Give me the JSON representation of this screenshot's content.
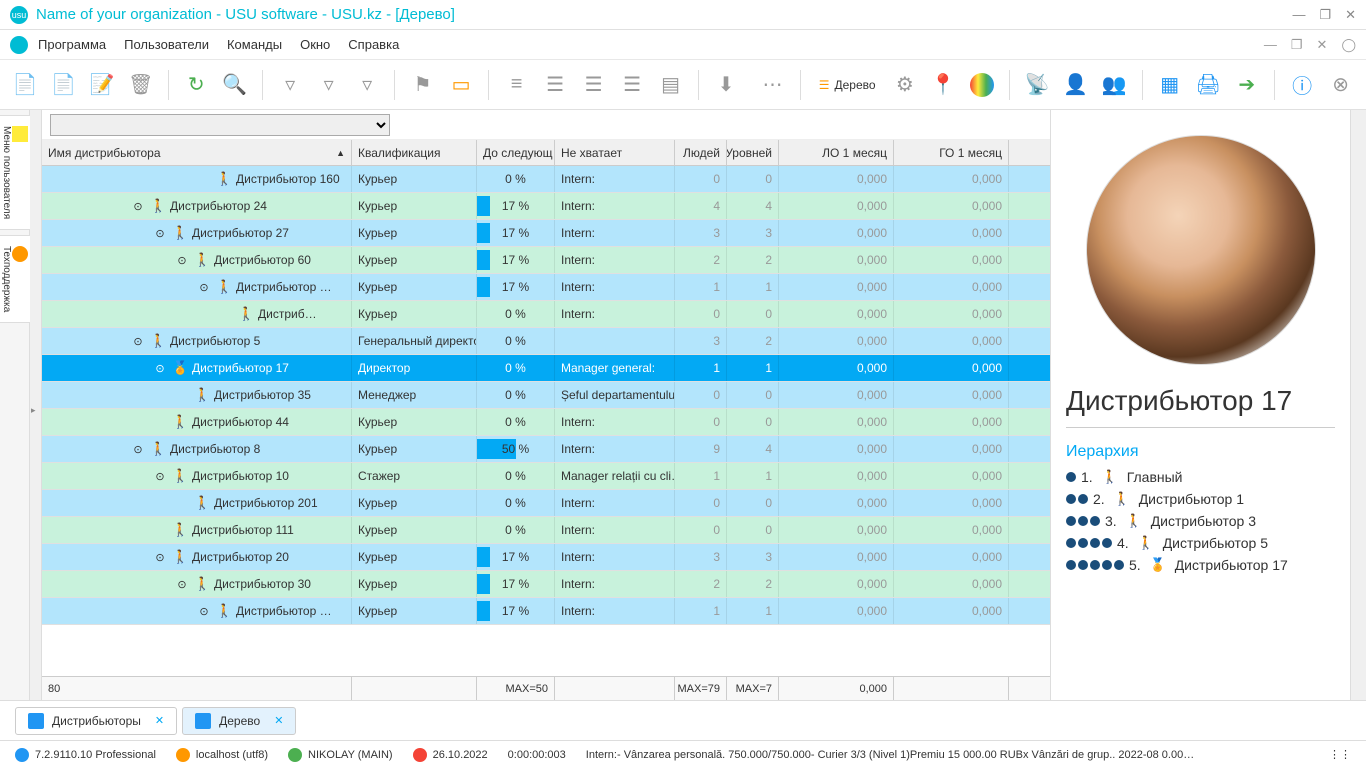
{
  "window": {
    "title": "Name of your organization - USU software - USU.kz - [Дерево]"
  },
  "menu": {
    "items": [
      "Программа",
      "Пользователи",
      "Команды",
      "Окно",
      "Справка"
    ]
  },
  "toolbar": {
    "tree_label": "Дерево"
  },
  "side_tabs": {
    "label1": "Меню пользователя",
    "label2": "Техподдержка"
  },
  "columns": {
    "name": "Имя дистрибьютора",
    "kval": "Квалификация",
    "next": "До следующ…",
    "miss": "Не хватает",
    "people": "Людей",
    "levels": "Уровней",
    "lo": "ЛО 1 месяц",
    "go": "ГО 1 месяц"
  },
  "rows": [
    {
      "indent": 7,
      "exp": "",
      "ico": "pc-blue",
      "name": "Дистрибьютор 160",
      "kval": "Курьер",
      "pct": 0,
      "miss": "Intern:",
      "ppl": "0",
      "lvl": "0",
      "lo": "0,000",
      "go": "0,000",
      "alt": "even"
    },
    {
      "indent": 4,
      "exp": "⊙",
      "ico": "pc-blue",
      "name": "Дистрибьютор 24",
      "kval": "Курьер",
      "pct": 17,
      "miss": "Intern:",
      "ppl": "4",
      "lvl": "4",
      "lo": "0,000",
      "go": "0,000",
      "alt": "odd"
    },
    {
      "indent": 5,
      "exp": "⊙",
      "ico": "pc-blue",
      "name": "Дистрибьютор 27",
      "kval": "Курьер",
      "pct": 17,
      "miss": "Intern:",
      "ppl": "3",
      "lvl": "3",
      "lo": "0,000",
      "go": "0,000",
      "alt": "even"
    },
    {
      "indent": 6,
      "exp": "⊙",
      "ico": "pc-blue",
      "name": "Дистрибьютор 60",
      "kval": "Курьер",
      "pct": 17,
      "miss": "Intern:",
      "ppl": "2",
      "lvl": "2",
      "lo": "0,000",
      "go": "0,000",
      "alt": "odd"
    },
    {
      "indent": 7,
      "exp": "⊙",
      "ico": "pc-blue",
      "name": "Дистрибьютор …",
      "kval": "Курьер",
      "pct": 17,
      "miss": "Intern:",
      "ppl": "1",
      "lvl": "1",
      "lo": "0,000",
      "go": "0,000",
      "alt": "even"
    },
    {
      "indent": 8,
      "exp": "",
      "ico": "pc-blue",
      "name": "Дистриб…",
      "kval": "Курьер",
      "pct": 0,
      "miss": "Intern:",
      "ppl": "0",
      "lvl": "0",
      "lo": "0,000",
      "go": "0,000",
      "alt": "odd"
    },
    {
      "indent": 4,
      "exp": "⊙",
      "ico": "pc-orange",
      "name": "Дистрибьютор 5",
      "kval": "Генеральный директор",
      "pct": 0,
      "miss": "",
      "ppl": "3",
      "lvl": "2",
      "lo": "0,000",
      "go": "0,000",
      "alt": "even"
    },
    {
      "indent": 5,
      "exp": "⊙",
      "ico": "pc-orange",
      "name": "Дистрибьютор 17",
      "kval": "Директор",
      "pct": 0,
      "miss": "Manager general:",
      "ppl": "1",
      "lvl": "1",
      "lo": "0,000",
      "go": "0,000",
      "alt": "sel",
      "star": true
    },
    {
      "indent": 6,
      "exp": "",
      "ico": "pc-brown",
      "name": "Дистрибьютор 35",
      "kval": "Менеджер",
      "pct": 0,
      "miss": "Șeful departamentului:",
      "ppl": "0",
      "lvl": "0",
      "lo": "0,000",
      "go": "0,000",
      "alt": "even"
    },
    {
      "indent": 5,
      "exp": "",
      "ico": "pc-blue",
      "name": "Дистрибьютор 44",
      "kval": "Курьер",
      "pct": 0,
      "miss": "Intern:",
      "ppl": "0",
      "lvl": "0",
      "lo": "0,000",
      "go": "0,000",
      "alt": "odd"
    },
    {
      "indent": 4,
      "exp": "⊙",
      "ico": "pc-blue",
      "name": "Дистрибьютор 8",
      "kval": "Курьер",
      "pct": 50,
      "miss": "Intern:",
      "ppl": "9",
      "lvl": "4",
      "lo": "0,000",
      "go": "0,000",
      "alt": "even"
    },
    {
      "indent": 5,
      "exp": "⊙",
      "ico": "pc-green",
      "name": "Дистрибьютор 10",
      "kval": "Стажер",
      "pct": 0,
      "miss": "Manager relații cu cli…",
      "ppl": "1",
      "lvl": "1",
      "lo": "0,000",
      "go": "0,000",
      "alt": "odd"
    },
    {
      "indent": 6,
      "exp": "",
      "ico": "pc-blue",
      "name": "Дистрибьютор 201",
      "kval": "Курьер",
      "pct": 0,
      "miss": "Intern:",
      "ppl": "0",
      "lvl": "0",
      "lo": "0,000",
      "go": "0,000",
      "alt": "even"
    },
    {
      "indent": 5,
      "exp": "",
      "ico": "pc-blue",
      "name": "Дистрибьютор 111",
      "kval": "Курьер",
      "pct": 0,
      "miss": "Intern:",
      "ppl": "0",
      "lvl": "0",
      "lo": "0,000",
      "go": "0,000",
      "alt": "odd"
    },
    {
      "indent": 5,
      "exp": "⊙",
      "ico": "pc-blue",
      "name": "Дистрибьютор 20",
      "kval": "Курьер",
      "pct": 17,
      "miss": "Intern:",
      "ppl": "3",
      "lvl": "3",
      "lo": "0,000",
      "go": "0,000",
      "alt": "even"
    },
    {
      "indent": 6,
      "exp": "⊙",
      "ico": "pc-blue",
      "name": "Дистрибьютор 30",
      "kval": "Курьер",
      "pct": 17,
      "miss": "Intern:",
      "ppl": "2",
      "lvl": "2",
      "lo": "0,000",
      "go": "0,000",
      "alt": "odd"
    },
    {
      "indent": 7,
      "exp": "⊙",
      "ico": "pc-blue",
      "name": "Дистрибьютор …",
      "kval": "Курьер",
      "pct": 17,
      "miss": "Intern:",
      "ppl": "1",
      "lvl": "1",
      "lo": "0,000",
      "go": "0,000",
      "alt": "even"
    }
  ],
  "footer": {
    "count": "80",
    "max_pct": "MAX=50",
    "max_ppl": "MAX=79",
    "max_lvl": "MAX=7",
    "sum_lo": "0,000",
    "sum_go": ""
  },
  "details": {
    "name": "Дистрибьютор 17",
    "hierarchy_label": "Иерархия",
    "hierarchy": [
      {
        "dots": 1,
        "num": "1.",
        "ico": "pc-blue",
        "label": "Главный"
      },
      {
        "dots": 2,
        "num": "2.",
        "ico": "pc-green",
        "label": "Дистрибьютор 1"
      },
      {
        "dots": 3,
        "num": "3.",
        "ico": "pc-brown",
        "label": "Дистрибьютор 3"
      },
      {
        "dots": 4,
        "num": "4.",
        "ico": "pc-orange",
        "label": "Дистрибьютор 5"
      },
      {
        "dots": 5,
        "num": "5.",
        "ico": "pc-orange",
        "label": "Дистрибьютор 17",
        "star": true
      }
    ]
  },
  "tabs": {
    "t1": "Дистрибьюторы",
    "t2": "Дерево"
  },
  "status": {
    "ver": "7.2.9110.10 Professional",
    "host": "localhost (utf8)",
    "user": "NIKOLAY (MAIN)",
    "date": "26.10.2022",
    "time": "0:00:00:003",
    "long": "Intern:- Vânzarea personală. 750.000/750.000- Curier 3/3 (Nivel 1)Premiu 15 000.00 RUBx   Vânzări de grup.. 2022-08 0.00…"
  }
}
